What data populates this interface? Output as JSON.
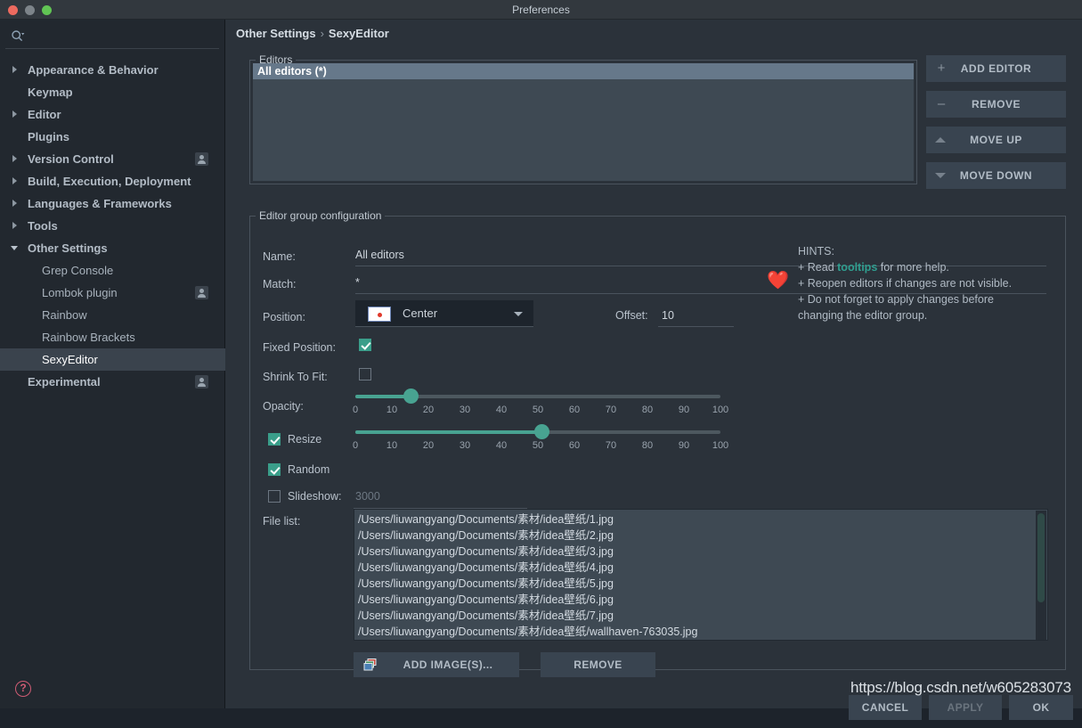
{
  "window": {
    "title": "Preferences",
    "traffic_lights": [
      "close-red",
      "minimize-gray",
      "maximize-green"
    ]
  },
  "sidebar": {
    "search": {
      "placeholder": "",
      "value": "",
      "icon": "search-icon"
    },
    "help_icon": "?",
    "items": [
      {
        "label": "Appearance & Behavior",
        "level": 0,
        "arrow": "collapsed",
        "badge": false,
        "selected": false
      },
      {
        "label": "Keymap",
        "level": 0,
        "arrow": "none",
        "badge": false,
        "selected": false
      },
      {
        "label": "Editor",
        "level": 0,
        "arrow": "collapsed",
        "badge": false,
        "selected": false
      },
      {
        "label": "Plugins",
        "level": 0,
        "arrow": "none",
        "badge": false,
        "selected": false
      },
      {
        "label": "Version Control",
        "level": 0,
        "arrow": "collapsed",
        "badge": true,
        "selected": false
      },
      {
        "label": "Build, Execution, Deployment",
        "level": 0,
        "arrow": "collapsed",
        "badge": false,
        "selected": false
      },
      {
        "label": "Languages & Frameworks",
        "level": 0,
        "arrow": "collapsed",
        "badge": false,
        "selected": false
      },
      {
        "label": "Tools",
        "level": 0,
        "arrow": "collapsed",
        "badge": false,
        "selected": false
      },
      {
        "label": "Other Settings",
        "level": 0,
        "arrow": "expanded",
        "badge": false,
        "selected": false
      },
      {
        "label": "Grep Console",
        "level": 1,
        "arrow": "none",
        "badge": false,
        "selected": false
      },
      {
        "label": "Lombok plugin",
        "level": 1,
        "arrow": "none",
        "badge": true,
        "selected": false
      },
      {
        "label": "Rainbow",
        "level": 1,
        "arrow": "none",
        "badge": false,
        "selected": false
      },
      {
        "label": "Rainbow Brackets",
        "level": 1,
        "arrow": "none",
        "badge": false,
        "selected": false
      },
      {
        "label": "SexyEditor",
        "level": 1,
        "arrow": "none",
        "badge": false,
        "selected": true
      },
      {
        "label": "Experimental",
        "level": 0,
        "arrow": "none",
        "badge": true,
        "selected": false
      }
    ]
  },
  "breadcrumb": {
    "parent": "Other Settings",
    "separator": "›",
    "current": "SexyEditor"
  },
  "editors_group": {
    "title": "Editors",
    "rows": [
      "All editors (*)"
    ]
  },
  "side_buttons": [
    {
      "label": "ADD EDITOR",
      "icon": "plus-icon"
    },
    {
      "label": "REMOVE",
      "icon": "minus-icon"
    },
    {
      "label": "MOVE UP",
      "icon": "triangle-up-icon"
    },
    {
      "label": "MOVE DOWN",
      "icon": "triangle-down-icon"
    }
  ],
  "config": {
    "title": "Editor group configuration",
    "name_label": "Name:",
    "name_value": "All editors",
    "match_label": "Match:",
    "match_value": "*",
    "position_label": "Position:",
    "position_value": "Center",
    "position_swatch": "center-dot-icon",
    "offset_label": "Offset:",
    "offset_value": "10",
    "fixed_position_label": "Fixed Position:",
    "fixed_position_checked": true,
    "shrink_to_fit_label": "Shrink To Fit:",
    "shrink_to_fit_checked": false,
    "opacity_label": "Opacity:",
    "opacity_value": 15,
    "resize_label": "Resize",
    "resize_checked": true,
    "resize_value": 51,
    "random_label": "Random",
    "random_checked": true,
    "slideshow_label": "Slideshow:",
    "slideshow_checked": false,
    "slideshow_value": "3000",
    "slider_ticks": [
      "0",
      "10",
      "20",
      "30",
      "40",
      "50",
      "60",
      "70",
      "80",
      "90",
      "100"
    ],
    "file_list_label": "File list:",
    "file_list": [
      "/Users/liuwangyang/Documents/素材/idea壁纸/1.jpg",
      "/Users/liuwangyang/Documents/素材/idea壁纸/2.jpg",
      "/Users/liuwangyang/Documents/素材/idea壁纸/3.jpg",
      "/Users/liuwangyang/Documents/素材/idea壁纸/4.jpg",
      "/Users/liuwangyang/Documents/素材/idea壁纸/5.jpg",
      "/Users/liuwangyang/Documents/素材/idea壁纸/6.jpg",
      "/Users/liuwangyang/Documents/素材/idea壁纸/7.jpg",
      "/Users/liuwangyang/Documents/素材/idea壁纸/wallhaven-763035.jpg"
    ],
    "add_images_label": "ADD IMAGE(S)...",
    "add_images_icon": "image-stack-icon",
    "remove_images_label": "REMOVE"
  },
  "hints": {
    "icon": "❤️",
    "heading": "HINTS:",
    "line1_pre": "+ Read ",
    "line1_link": "tooltips",
    "line1_post": " for more help.",
    "line2": "+ Reopen editors if changes are not visible.",
    "line3": "+ Do not forget to apply changes before",
    "line4": "changing the editor group."
  },
  "footer": {
    "cancel_label": "CANCEL",
    "apply_label": "APPLY",
    "ok_label": "OK"
  },
  "watermark": {
    "text": "https://blog.csdn.net/w605283073"
  },
  "colors": {
    "accent_teal": "#48a391",
    "selection_blue": "#66788a",
    "panel_bg": "#2b323a",
    "sidebar_bg": "#22282f",
    "list_bg": "#3e4953",
    "hint_link": "#2f9e8f",
    "help_pink": "#cf5c74"
  }
}
